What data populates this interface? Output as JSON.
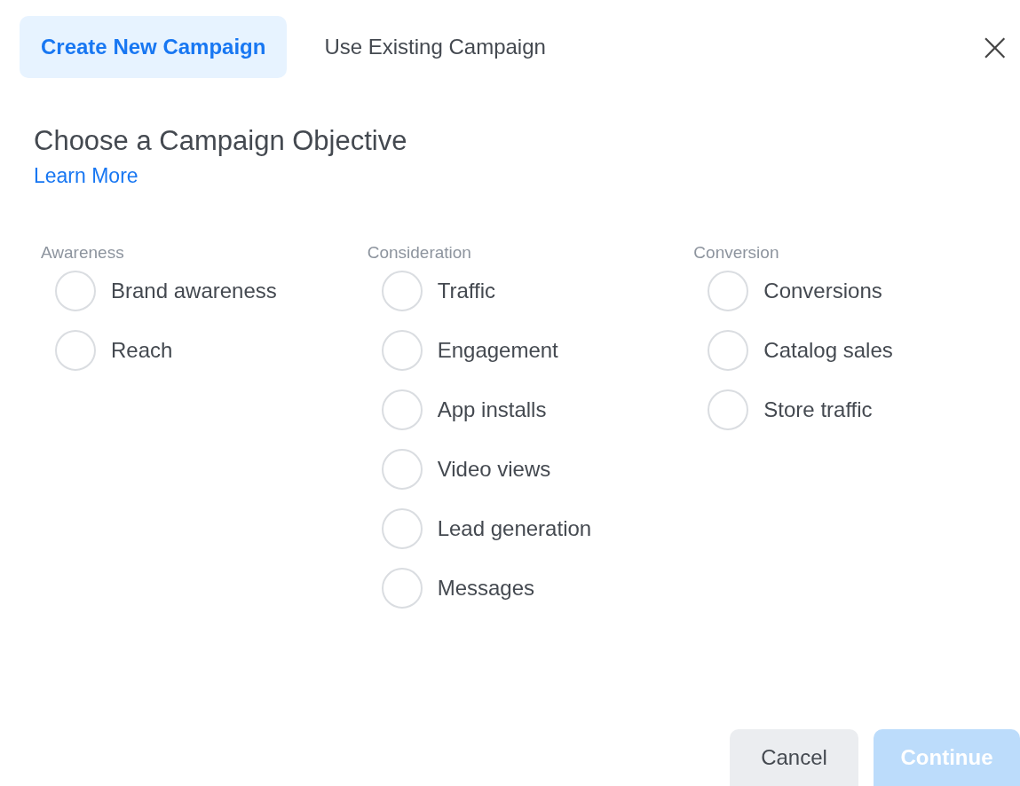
{
  "tabs": [
    {
      "label": "Create New Campaign",
      "selected": true
    },
    {
      "label": "Use Existing Campaign",
      "selected": false
    }
  ],
  "close": "×",
  "title": "Choose a Campaign Objective",
  "link": "Learn More",
  "groups": [
    {
      "heading": "Awareness",
      "options": [
        {
          "label": "Brand awareness",
          "selected": false
        },
        {
          "label": "Reach",
          "selected": false
        }
      ]
    },
    {
      "heading": "Consideration",
      "options": [
        {
          "label": "Traffic",
          "selected": false
        },
        {
          "label": "Engagement",
          "selected": false
        },
        {
          "label": "App installs",
          "selected": false
        },
        {
          "label": "Video views",
          "selected": false
        },
        {
          "label": "Lead generation",
          "selected": false
        },
        {
          "label": "Messages",
          "selected": false
        }
      ]
    },
    {
      "heading": "Conversion",
      "options": [
        {
          "label": "Conversions",
          "selected": false
        },
        {
          "label": "Catalog sales",
          "selected": false
        },
        {
          "label": "Store traffic",
          "selected": false
        }
      ]
    }
  ],
  "buttons": [
    {
      "label": "Cancel",
      "kind": "secondary",
      "disabled": false
    },
    {
      "label": "Continue",
      "kind": "primary",
      "disabled": true
    }
  ]
}
